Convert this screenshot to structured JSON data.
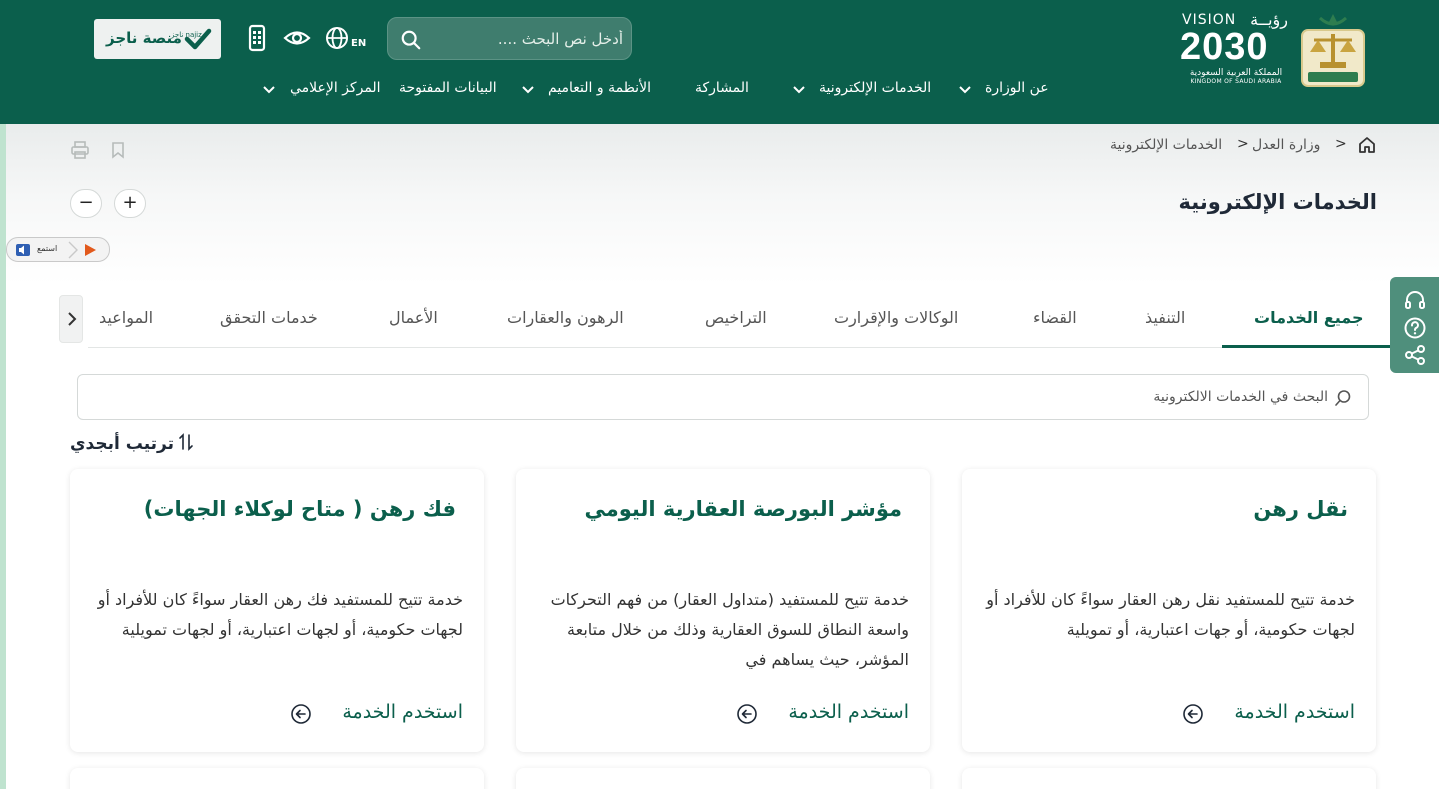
{
  "header": {
    "vision_en": "VISION",
    "vision_ar": "رؤيــة",
    "vision_year": "2030",
    "vision_kingdom_ar": "المملكة العربية السعودية",
    "vision_kingdom_en": "KINGDOM OF SAUDI ARABIA",
    "search_placeholder": "أدخل نص البحث ....",
    "lang": "EN",
    "najiz_label": "منصة ناجز",
    "najiz_sub": "ناجز najiz"
  },
  "nav": {
    "items": [
      {
        "label": "عن الوزارة",
        "has_menu": true
      },
      {
        "label": "الخدمات الإلكترونية",
        "has_menu": true
      },
      {
        "label": "المشاركة",
        "has_menu": false
      },
      {
        "label": "الأنظمة و التعاميم",
        "has_menu": true
      },
      {
        "label": "البيانات المفتوحة",
        "has_menu": false
      },
      {
        "label": "المركز الإعلامي",
        "has_menu": true
      }
    ]
  },
  "breadcrumb": {
    "items": [
      "وزارة العدل",
      "الخدمات الإلكترونية"
    ],
    "separator": ">"
  },
  "page": {
    "title": "الخدمات الإلكترونية",
    "zoom_in": "+",
    "zoom_out": "−",
    "listen_label": "استمع"
  },
  "tabs": {
    "items": [
      {
        "label": "جميع الخدمات",
        "active": true
      },
      {
        "label": "التنفيذ",
        "active": false
      },
      {
        "label": "القضاء",
        "active": false
      },
      {
        "label": "الوكالات والإقرارت",
        "active": false
      },
      {
        "label": "التراخيص",
        "active": false
      },
      {
        "label": "الرهون والعقارات",
        "active": false
      },
      {
        "label": "الأعمال",
        "active": false
      },
      {
        "label": "خدمات التحقق",
        "active": false
      },
      {
        "label": "المواعيد",
        "active": false
      }
    ]
  },
  "services_search": {
    "placeholder": "البحث في الخدمات الالكترونية"
  },
  "sort": {
    "label": "ترتيب أبجدي"
  },
  "cards": [
    {
      "title": "نقل رهن",
      "description": "خدمة تتيح للمستفيد نقل رهن العقار سواءً كان للأفراد أو لجهات حكومية، أو جهات اعتبارية، أو تمويلية",
      "link": "استخدم الخدمة"
    },
    {
      "title": "مؤشر البورصة العقارية اليومي",
      "description": "خدمة تتيح للمستفيد (متداول العقار) من فهم التحركات واسعة النطاق للسوق العقارية وذلك من خلال متابعة المؤشر، حيث يساهم في",
      "link": "استخدم الخدمة"
    },
    {
      "title": "فك رهن ( متاح لوكلاء الجهات)",
      "description": "خدمة تتيح للمستفيد فك رهن العقار سواءً كان للأفراد أو لجهات حكومية، أو لجهات اعتبارية، أو لجهات تمويلية",
      "link": "استخدم الخدمة"
    }
  ],
  "colors": {
    "brand_green": "#0b5f4c",
    "side_panel": "#4f8f7c"
  }
}
